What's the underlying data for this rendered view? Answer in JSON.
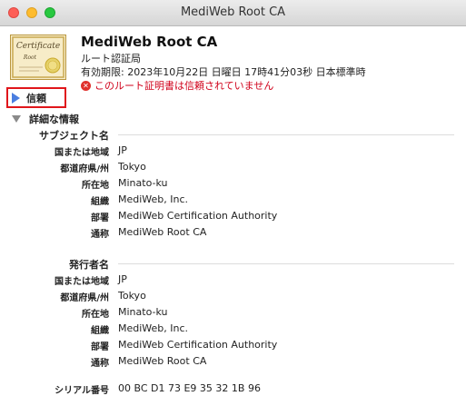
{
  "window": {
    "title": "MediWeb Root CA"
  },
  "certificate": {
    "name": "MediWeb Root CA",
    "kind": "ルート認証局",
    "expires": "有効期限: 2023年10月22日 日曜日 17時41分03秒 日本標準時",
    "warning": "このルート証明書は信頼されていません",
    "icon_text": "Certificate",
    "icon_subtext": "Root"
  },
  "trust": {
    "label": "信頼"
  },
  "details": {
    "label": "詳細な情報",
    "subject": {
      "title": "サブジェクト名",
      "fields": [
        {
          "key": "国または地域",
          "value": "JP"
        },
        {
          "key": "都道府県/州",
          "value": "Tokyo"
        },
        {
          "key": "所在地",
          "value": "Minato-ku"
        },
        {
          "key": "組織",
          "value": "MediWeb, Inc."
        },
        {
          "key": "部署",
          "value": "MediWeb Certification Authority"
        },
        {
          "key": "通称",
          "value": "MediWeb Root CA"
        }
      ]
    },
    "issuer": {
      "title": "発行者名",
      "fields": [
        {
          "key": "国または地域",
          "value": "JP"
        },
        {
          "key": "都道府県/州",
          "value": "Tokyo"
        },
        {
          "key": "所在地",
          "value": "Minato-ku"
        },
        {
          "key": "組織",
          "value": "MediWeb, Inc."
        },
        {
          "key": "部署",
          "value": "MediWeb Certification Authority"
        },
        {
          "key": "通称",
          "value": "MediWeb Root CA"
        }
      ]
    },
    "serial": {
      "key": "シリアル番号",
      "value": "00 BC D1 73 E9 35 32 1B 96"
    }
  },
  "colors": {
    "warning": "#d0021b",
    "highlight_border": "#e0161b",
    "disclosure": "#4a7ee0"
  },
  "icons": {
    "close": "close-icon",
    "minimize": "minimize-icon",
    "zoom": "zoom-icon",
    "certificate": "certificate-icon",
    "warning": "error-x-icon",
    "trust_disclosure": "disclosure-right-icon",
    "details_disclosure": "disclosure-down-icon"
  }
}
